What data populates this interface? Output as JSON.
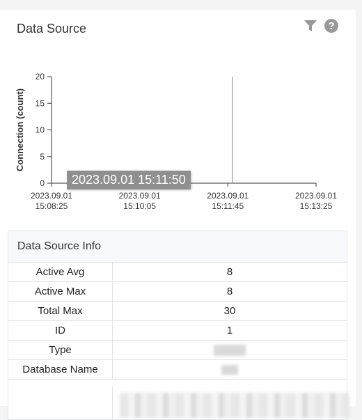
{
  "header": {
    "title": "Data Source",
    "filter_icon": "filter-icon",
    "help_icon": "help-icon"
  },
  "colors": {
    "icon": "#999999",
    "axis": "#333333",
    "tooltip_bg": "#8f8f8f"
  },
  "chart_data": {
    "type": "line",
    "ylabel": "Connection (count)",
    "ylim": [
      0,
      20
    ],
    "yticks": [
      "20",
      "15",
      "10",
      "5",
      "0"
    ],
    "xticks": [
      {
        "date": "2023.09.01",
        "time": "15:08:25"
      },
      {
        "date": "2023.09.01",
        "time": "15:10:05"
      },
      {
        "date": "2023.09.01",
        "time": "15:11:45"
      },
      {
        "date": "2023.09.01",
        "time": "15:13:25"
      }
    ],
    "cursor_time": "2023.09.01 15:11:50",
    "tooltip": "2023.09.01 15:11:50"
  },
  "info": {
    "title": "Data Source Info",
    "rows": [
      {
        "key": "Active Avg",
        "value": "8"
      },
      {
        "key": "Active Max",
        "value": "8"
      },
      {
        "key": "Total Max",
        "value": "30"
      },
      {
        "key": "ID",
        "value": "1"
      },
      {
        "key": "Type",
        "value": ""
      },
      {
        "key": "Database Name",
        "value": ""
      }
    ]
  }
}
